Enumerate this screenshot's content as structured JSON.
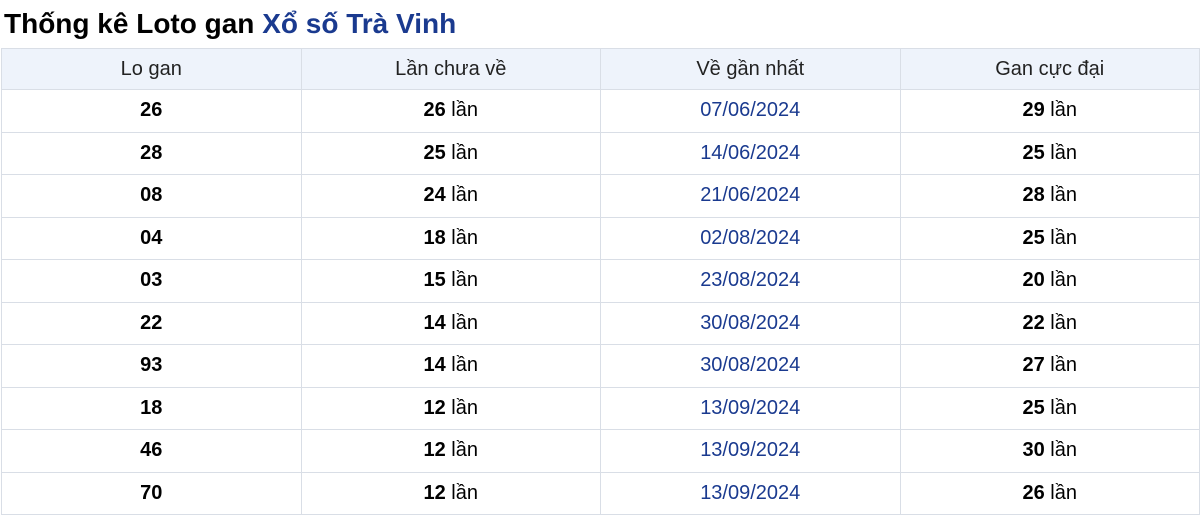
{
  "title": {
    "prefix": "Thống kê Loto gan",
    "link": "Xổ số Trà Vinh"
  },
  "table": {
    "headers": [
      "Lo gan",
      "Lần chưa về",
      "Về gần nhất",
      "Gan cực đại"
    ],
    "unit": "lần",
    "rows": [
      {
        "number": "26",
        "missed": "26",
        "last": "07/06/2024",
        "max": "29"
      },
      {
        "number": "28",
        "missed": "25",
        "last": "14/06/2024",
        "max": "25"
      },
      {
        "number": "08",
        "missed": "24",
        "last": "21/06/2024",
        "max": "28"
      },
      {
        "number": "04",
        "missed": "18",
        "last": "02/08/2024",
        "max": "25"
      },
      {
        "number": "03",
        "missed": "15",
        "last": "23/08/2024",
        "max": "20"
      },
      {
        "number": "22",
        "missed": "14",
        "last": "30/08/2024",
        "max": "22"
      },
      {
        "number": "93",
        "missed": "14",
        "last": "30/08/2024",
        "max": "27"
      },
      {
        "number": "18",
        "missed": "12",
        "last": "13/09/2024",
        "max": "25"
      },
      {
        "number": "46",
        "missed": "12",
        "last": "13/09/2024",
        "max": "30"
      },
      {
        "number": "70",
        "missed": "12",
        "last": "13/09/2024",
        "max": "26"
      }
    ]
  }
}
